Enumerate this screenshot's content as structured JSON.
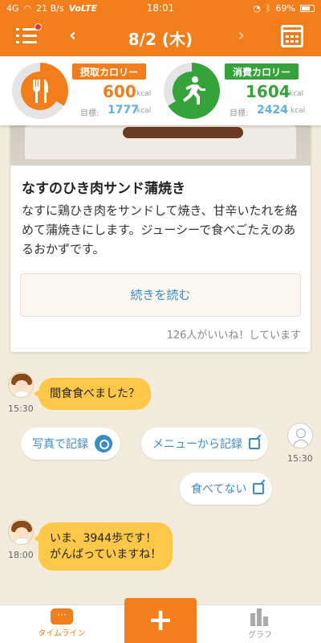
{
  "status_bar": {
    "signal": "4G",
    "speed": "21 B/s",
    "network": "VoLTE",
    "time": "18:01",
    "battery": "69%"
  },
  "header": {
    "date": "8/2 (木)",
    "prev": "‹",
    "next": "›"
  },
  "calories": {
    "intake": {
      "label": "摂取カロリー",
      "value": "600",
      "unit": "kcal",
      "goal_label": "目標:",
      "goal": "1777",
      "goal_unit": "kcal",
      "progress": 0.34,
      "color": "#f27e1b",
      "icon": "fork-knife-icon"
    },
    "burned": {
      "label": "消費カロリー",
      "value": "1604",
      "unit": "kcal",
      "goal_label": "目標:",
      "goal": "2424",
      "goal_unit": "kcal",
      "progress": 0.66,
      "color": "#35a33a",
      "icon": "running-man-icon"
    }
  },
  "recipe": {
    "title": "なすのひき肉サンド蒲焼き",
    "description": "なすに鶏ひき肉をサンドして焼き、甘辛いたれを絡めて蒲焼きにします。ジューシーで食べごたえのあるおかずです。",
    "read_more": "続きを読む",
    "likes": "126人がいいね！しています"
  },
  "chat": {
    "msg1": {
      "text": "間食食べました？",
      "time": "15:30"
    },
    "options": {
      "photo": "写真で記録",
      "menu": "メニューから記録",
      "none": "食べてない",
      "time": "15:30"
    },
    "msg2": {
      "line1": "いま、3944歩です！",
      "line2": "がんばっていますね！",
      "time": "18:00"
    }
  },
  "bottom_nav": {
    "timeline": "タイムライン",
    "add": "+",
    "graph": "グラフ"
  },
  "colors": {
    "accent": "#f27e1b",
    "green": "#35a33a",
    "link": "#3a8cc6",
    "bubble": "#fdc84a"
  }
}
